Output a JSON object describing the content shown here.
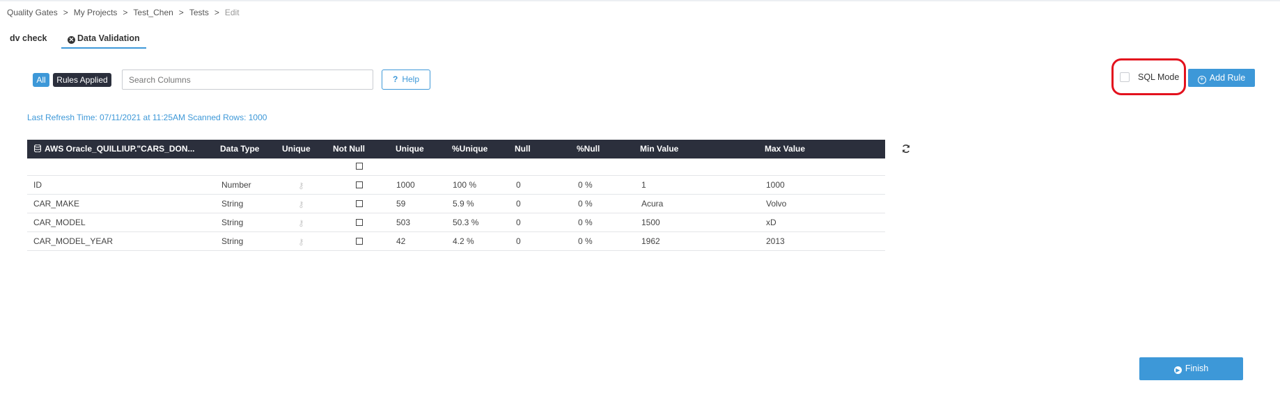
{
  "breadcrumb": [
    {
      "label": "Quality Gates"
    },
    {
      "label": "My Projects"
    },
    {
      "label": "Test_Chen"
    },
    {
      "label": "Tests"
    },
    {
      "label": "Edit"
    }
  ],
  "breadcrumb_separator": ">",
  "tabs": [
    {
      "label": "dv check"
    },
    {
      "label": "Data Validation",
      "active": true
    }
  ],
  "filters": {
    "all_label": "All",
    "rules_applied_label": "Rules Applied"
  },
  "search": {
    "placeholder": "Search Columns",
    "value": ""
  },
  "help": {
    "label": "Help",
    "icon": "?"
  },
  "sql_mode": {
    "label": "SQL Mode",
    "checked": false,
    "highlight_color": "#e3111d"
  },
  "add_rule": {
    "label": "Add Rule"
  },
  "refresh_info": "Last Refresh Time: 07/11/2021 at 11:25AM Scanned Rows: 1000",
  "table": {
    "headers": [
      "AWS Oracle_QUILLIUP.\"CARS_DON...",
      "Data Type",
      "Unique",
      "Not Null",
      "Unique",
      "%Unique",
      "Null",
      "%Null",
      "Min Value",
      "Max Value"
    ],
    "rows": [
      {
        "column": "ID",
        "data_type": "Number",
        "unique_count": "1000",
        "pct_unique": "100 %",
        "null_count": "0",
        "pct_null": "0 %",
        "min": "1",
        "max": "1000"
      },
      {
        "column": "CAR_MAKE",
        "data_type": "String",
        "unique_count": "59",
        "pct_unique": "5.9 %",
        "null_count": "0",
        "pct_null": "0 %",
        "min": "Acura",
        "max": "Volvo"
      },
      {
        "column": "CAR_MODEL",
        "data_type": "String",
        "unique_count": "503",
        "pct_unique": "50.3 %",
        "null_count": "0",
        "pct_null": "0 %",
        "min": "1500",
        "max": "xD"
      },
      {
        "column": "CAR_MODEL_YEAR",
        "data_type": "String",
        "unique_count": "42",
        "pct_unique": "4.2 %",
        "null_count": "0",
        "pct_null": "0 %",
        "min": "1962",
        "max": "2013"
      }
    ]
  },
  "finish": {
    "label": "Finish"
  },
  "colors": {
    "accent": "#3d98d8",
    "header_bg": "#2b2f3c"
  }
}
